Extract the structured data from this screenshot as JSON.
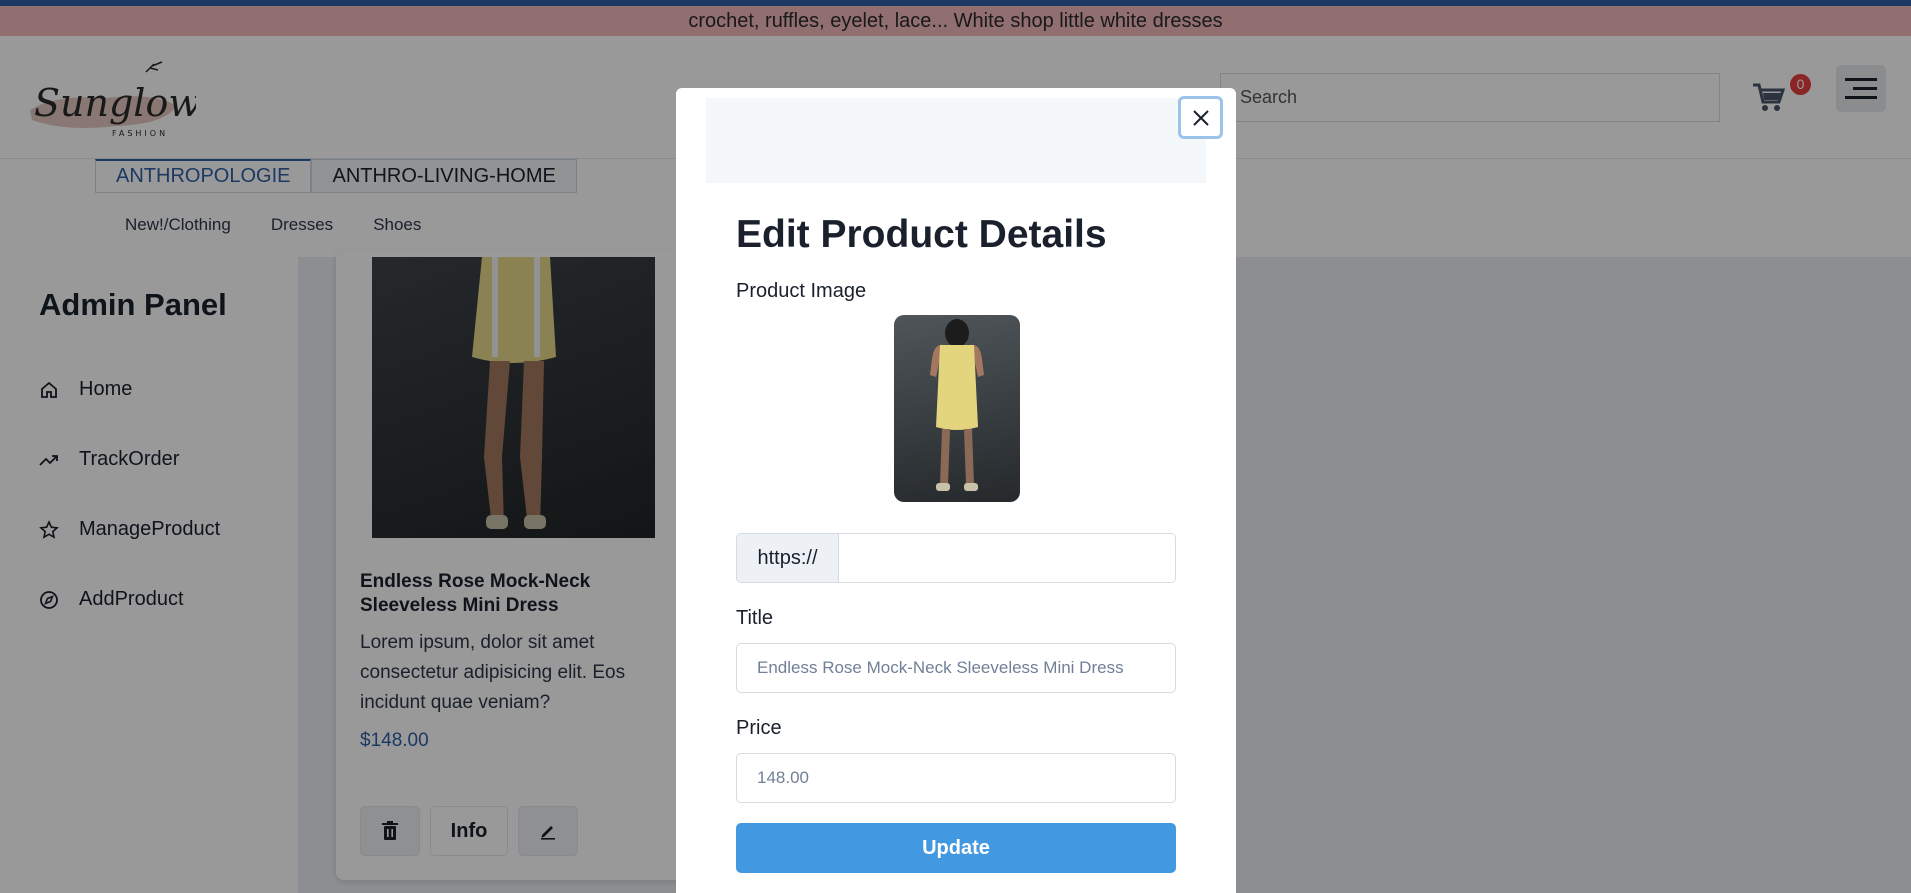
{
  "announcement": "crochet, ruffles, eyelet, lace... White shop little white dresses",
  "header": {
    "logo_text": "Sunglow",
    "logo_sub": "FASHION",
    "search_placeholder": "Search",
    "cart_count": "0"
  },
  "tabs": [
    {
      "label": "ANTHROPOLOGIE",
      "active": true
    },
    {
      "label": "ANTHRO-LIVING-HOME",
      "active": false
    }
  ],
  "subnav": [
    "New!/Clothing",
    "Dresses",
    "Shoes"
  ],
  "sidebar": {
    "title": "Admin Panel",
    "items": [
      {
        "label": "Home",
        "icon": "home-icon"
      },
      {
        "label": "TrackOrder",
        "icon": "trending-up-icon"
      },
      {
        "label": "ManageProduct",
        "icon": "star-icon"
      },
      {
        "label": "AddProduct",
        "icon": "compass-icon"
      }
    ]
  },
  "card": {
    "title": "Endless Rose Mock-Neck Sleeveless Mini Dress",
    "description": "Lorem ipsum, dolor sit amet consectetur adipisicing elit. Eos incidunt quae veniam?",
    "price": "$148.00",
    "info_label": "Info"
  },
  "modal": {
    "title": "Edit Product Details",
    "image_label": "Product Image",
    "url_prefix": "https://",
    "title_label": "Title",
    "title_placeholder": "Endless Rose Mock-Neck Sleeveless Mini Dress",
    "price_label": "Price",
    "price_placeholder": "148.00",
    "update_label": "Update"
  },
  "colors": {
    "accent": "#4299e1",
    "brand_blue": "#2f5fa6",
    "announce_bg": "#f2b8bb",
    "badge": "#e53e3e"
  }
}
